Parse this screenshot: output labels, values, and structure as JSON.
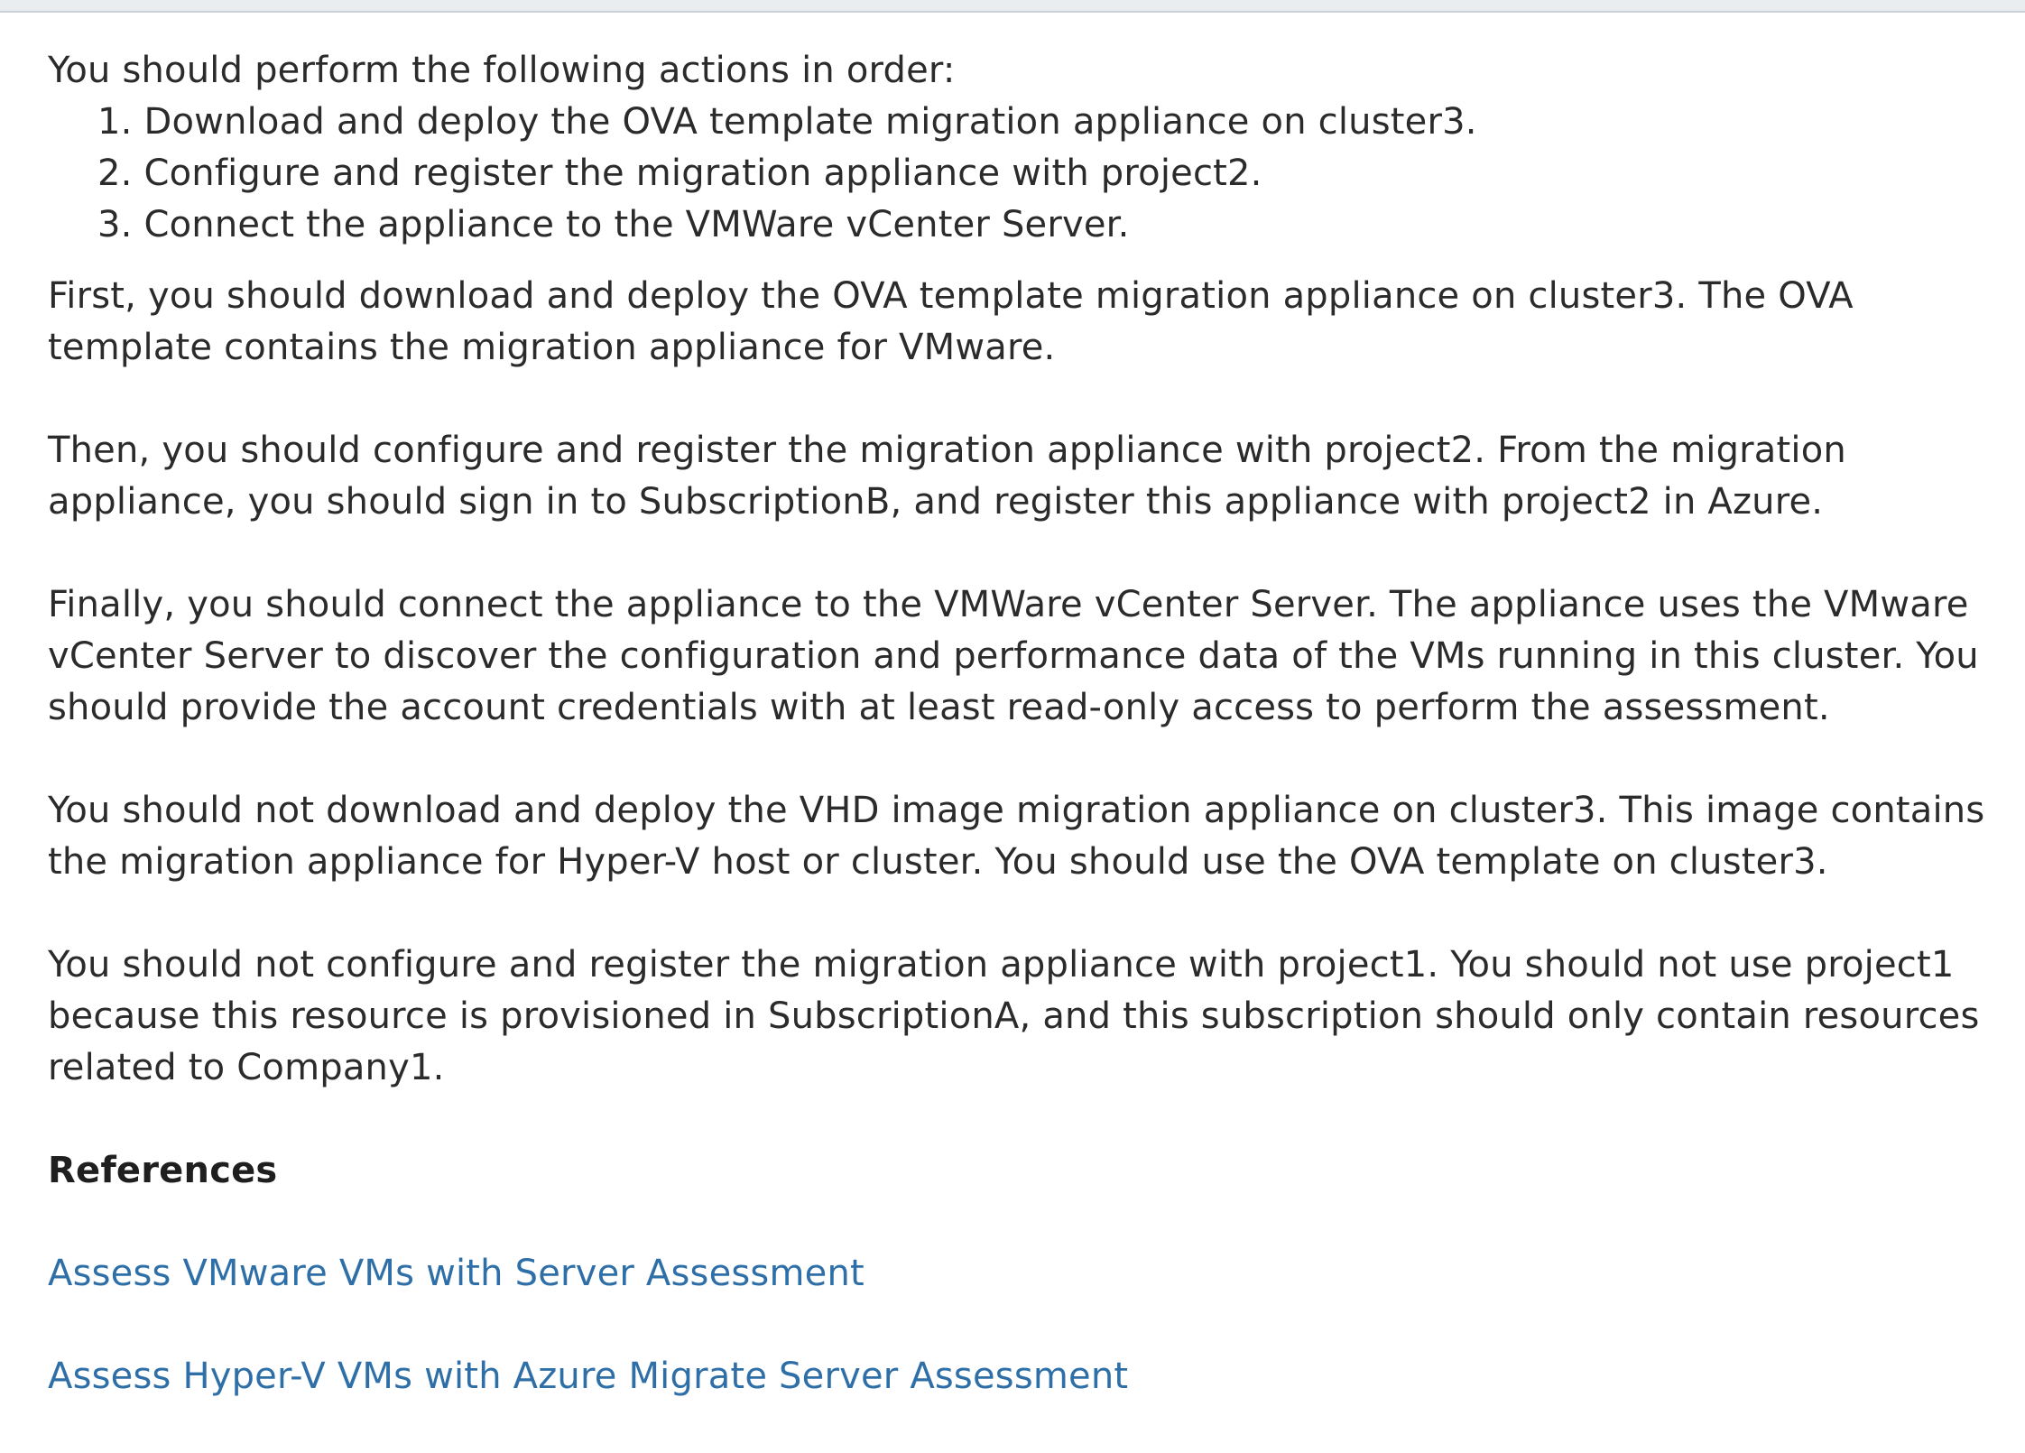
{
  "intro": "You should perform the following actions in order:",
  "steps": [
    "1. Download and deploy the OVA template migration appliance on cluster3.",
    "2. Configure and register the migration appliance with project2.",
    "3. Connect the appliance to the VMWare vCenter Server."
  ],
  "paragraphs": [
    "First, you should download and deploy the OVA template migration appliance on cluster3. The OVA template contains the migration appliance for VMware.",
    "Then, you should configure and register the migration appliance with project2. From the migration appliance, you should sign in to SubscriptionB, and register this appliance with project2 in Azure.",
    "Finally, you should connect the appliance to the VMWare vCenter Server. The appliance uses the VMware vCenter Server to discover the configuration and performance data of the VMs running in this cluster. You should provide the account credentials with at least read-only access to perform the assessment.",
    "You should not download and deploy the VHD image migration appliance on cluster3. This image contains the migration appliance for Hyper-V host or cluster. You should use the OVA template on cluster3.",
    "You should not configure and register the migration appliance with project1. You should not use project1 because this resource is provisioned in SubscriptionA, and this subscription should only contain resources related to Company1."
  ],
  "references": {
    "heading": "References",
    "links": [
      "Assess VMware VMs with Server Assessment",
      "Assess Hyper-V VMs with Azure Migrate Server Assessment"
    ]
  },
  "colors": {
    "text": "#2b2b2b",
    "link": "#2f6fa8",
    "top_strip": "#e9edf0"
  }
}
